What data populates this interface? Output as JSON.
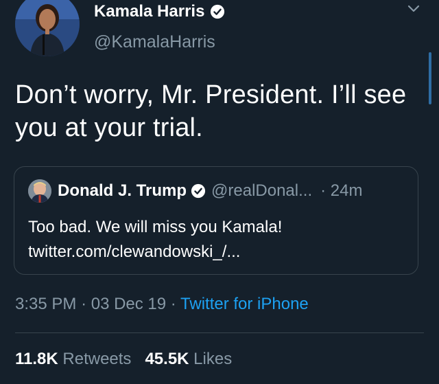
{
  "colors": {
    "background": "#15202b",
    "text": "#ffffff",
    "secondary": "#8899a6",
    "link": "#1da1f2",
    "border": "#38444d"
  },
  "tweet": {
    "author": {
      "name": "Kamala Harris",
      "handle": "@KamalaHarris",
      "verified_icon": "verified-badge-icon",
      "avatar_icon": "profile-photo"
    },
    "text": "Don’t worry, Mr. President. I’ll see you at your trial.",
    "quoted_tweet": {
      "author_name": "Donald J. Trump",
      "author_handle": "@realDonal...",
      "time": "· 24m",
      "text_line1": "Too bad. We will miss you Kamala!",
      "text_line2": "twitter.com/clewandowski_/..."
    },
    "meta": {
      "time": "3:35 PM",
      "date": "· 03 Dec 19 ·",
      "source": "Twitter for iPhone"
    },
    "stats": {
      "retweets_count": "11.8K",
      "retweets_label": "Retweets",
      "likes_count": "45.5K",
      "likes_label": "Likes"
    }
  }
}
